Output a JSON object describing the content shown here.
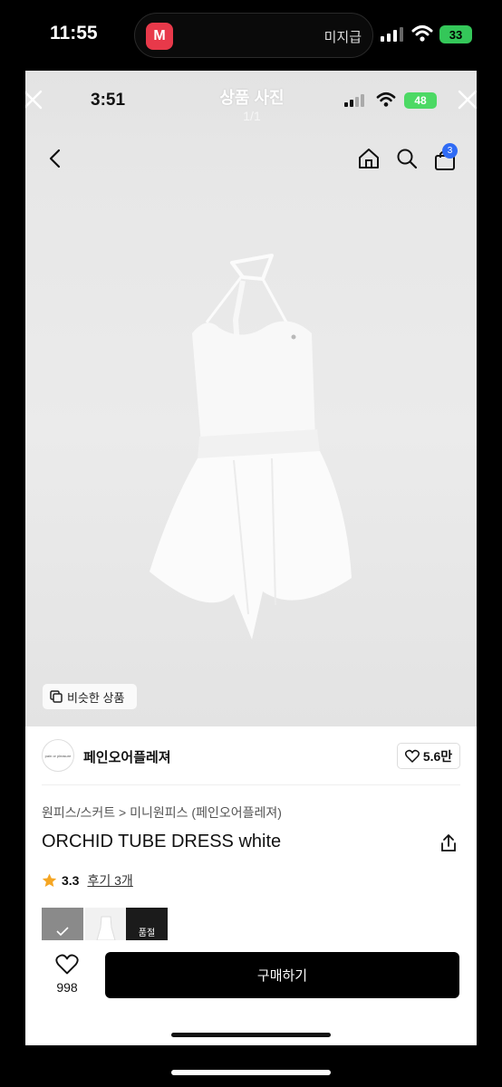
{
  "outer_status": {
    "time": "11:55",
    "app_badge_glyph": "M",
    "carrier_label": "미지급",
    "battery": "33"
  },
  "inner_status": {
    "time": "3:51",
    "battery": "48"
  },
  "viewer": {
    "title": "상품 사진",
    "page_counter": "1/1"
  },
  "nav": {
    "cart_count": "3"
  },
  "image_overlay": {
    "similar_label": "비슷한 상품"
  },
  "brand": {
    "logo_text": "pain or pleasure",
    "name": "페인오어플레져",
    "like_count": "5.6만"
  },
  "product": {
    "breadcrumb": "원피스/스커트 > 미니원피스 (페인오어플레져)",
    "name": "ORCHID TUBE DRESS white",
    "rating": "3.3",
    "reviews": "후기 3개",
    "soldout_label": "품절"
  },
  "bottom": {
    "wish_count": "998",
    "buy_label": "구매하기"
  },
  "colors": {
    "buy_button": "#000000",
    "cart_badge": "#2f6bf5",
    "star": "#f5a623",
    "battery_outer": "#34c759",
    "battery_inner": "#4cd964"
  },
  "icons": [
    "close-icon",
    "back-icon",
    "home-icon",
    "search-icon",
    "bag-icon",
    "similar-icon",
    "heart-icon",
    "share-icon",
    "star-icon",
    "wifi-icon",
    "signal-icon"
  ]
}
